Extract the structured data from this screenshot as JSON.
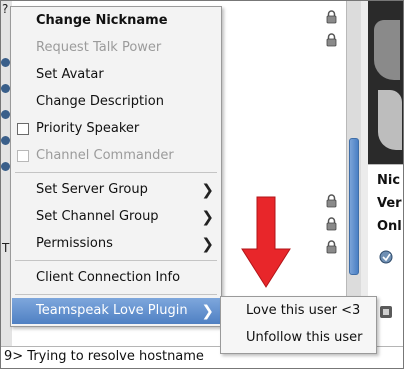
{
  "background": {
    "left_chars": [
      "?",
      "T"
    ],
    "info_labels": [
      "Nic",
      "Ver",
      "Onl"
    ],
    "status_text": "9>  Trying to resolve hostname"
  },
  "context_menu": {
    "items": [
      {
        "label": "Change Nickname",
        "bold": true,
        "disabled": false
      },
      {
        "label": "Request Talk Power",
        "disabled": true
      },
      {
        "label": "Set Avatar",
        "disabled": false
      },
      {
        "label": "Change Description",
        "disabled": false
      },
      {
        "label": "Priority Speaker",
        "checkbox": true,
        "checked": false,
        "disabled": false
      },
      {
        "label": "Channel Commander",
        "checkbox": true,
        "checked": false,
        "disabled": true
      },
      {
        "label": "Set Server Group",
        "submenu": true
      },
      {
        "label": "Set Channel Group",
        "submenu": true
      },
      {
        "label": "Permissions",
        "submenu": true
      },
      {
        "label": "Client Connection Info"
      },
      {
        "label": "Teamspeak Love Plugin",
        "submenu": true,
        "active": true
      }
    ]
  },
  "submenu": {
    "items": [
      {
        "label": "Love this user <3"
      },
      {
        "label": "Unfollow this user"
      }
    ]
  },
  "colors": {
    "highlight": "#5a8ad0",
    "annotation_arrow": "#e8262a",
    "disabled_text": "#9b9b9b"
  },
  "icons": {
    "lock": "lock-icon",
    "submenu_arrow": "chevron-right-icon",
    "annotation": "down-arrow-icon"
  }
}
